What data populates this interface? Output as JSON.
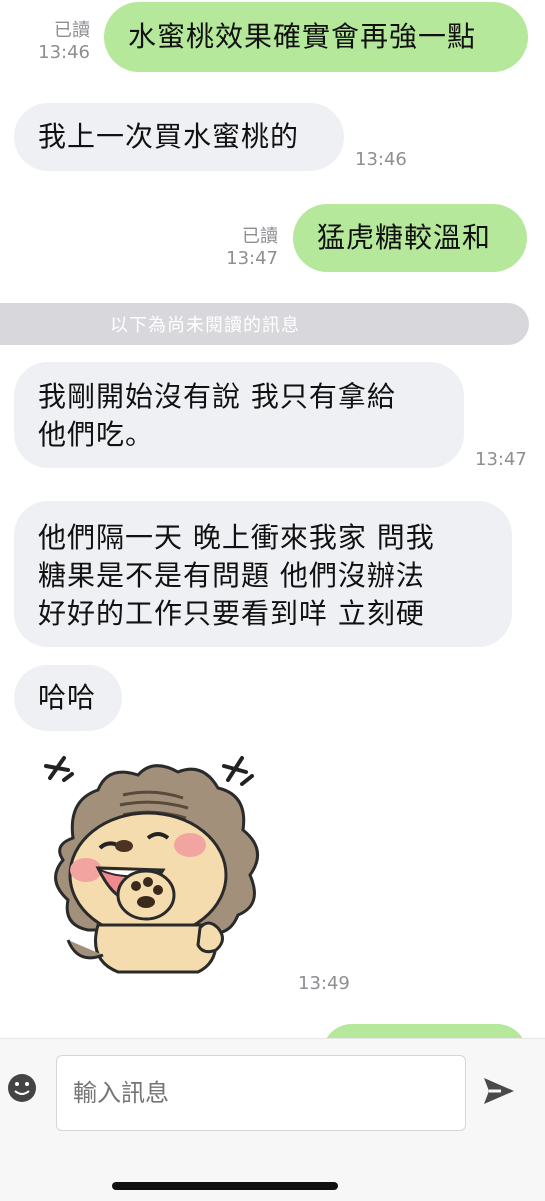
{
  "messages": [
    {
      "direction": "out",
      "text": "水蜜桃效果確實會再強一點",
      "read": "已讀",
      "time": "13:46"
    },
    {
      "direction": "in",
      "text": "我上一次買水蜜桃的",
      "time": "13:46"
    },
    {
      "direction": "out",
      "text": "猛虎糖較溫和",
      "read": "已讀",
      "time": "13:47"
    },
    {
      "direction": "in",
      "text": "我剛開始沒有說  我只有拿給\n他們吃。",
      "time": "13:47"
    },
    {
      "direction": "in",
      "text": "他們隔一天 晚上衝來我家 問我\n糖果是不是有問題  他們沒辦法\n好好的工作只要看到咩 立刻硬",
      "time": ""
    },
    {
      "direction": "in",
      "text": "哈哈",
      "time": ""
    },
    {
      "direction": "in",
      "type": "sticker",
      "sticker": "lion-laughing-sticker",
      "time": "13:49"
    }
  ],
  "unread_divider": "以下為尚未閱讀的訊息",
  "composer": {
    "placeholder": "輸入訊息"
  },
  "icons": {
    "emoji": "emoji-icon",
    "send": "send-icon"
  },
  "colors": {
    "out_bubble": "#b6e89b",
    "in_bubble": "#eff0f3",
    "meta": "#8e8e93"
  }
}
